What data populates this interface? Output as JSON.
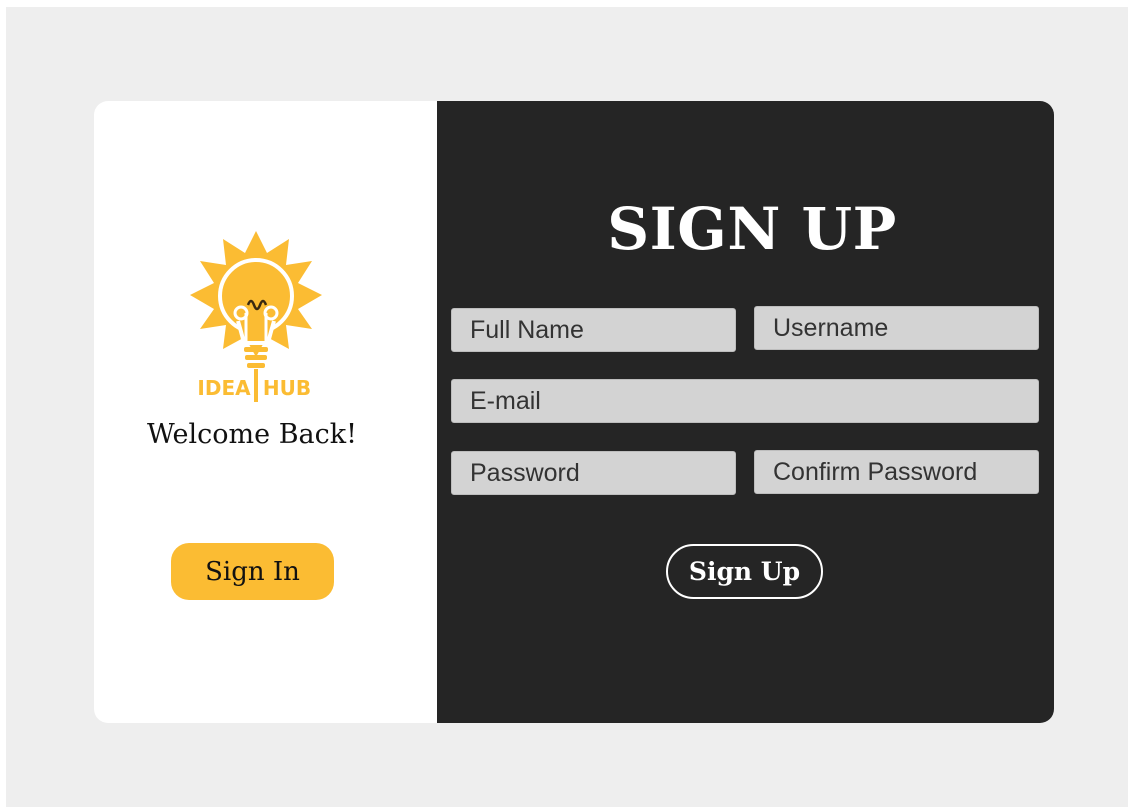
{
  "brand": {
    "logo_text": "IDEA HUB",
    "icon": "lightbulb-sun-icon",
    "accent_color": "#fbbc33"
  },
  "left_panel": {
    "welcome_text": "Welcome Back!",
    "sign_in_label": "Sign In"
  },
  "right_panel": {
    "title": "SIGN UP",
    "fields": {
      "full_name": "Full Name",
      "username": "Username",
      "email": "E-mail",
      "password": "Password",
      "confirm_password": "Confirm Password"
    },
    "sign_up_label": "Sign Up"
  },
  "colors": {
    "page_background": "#eeeeee",
    "left_panel": "#ffffff",
    "right_panel": "#252525",
    "field_background": "#d3d3d3"
  }
}
